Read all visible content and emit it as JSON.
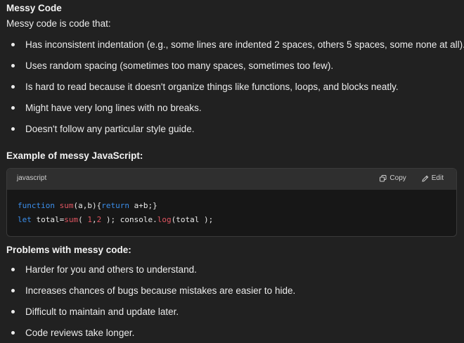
{
  "section1": {
    "title": "Messy Code",
    "intro": "Messy code is code that:",
    "bullets": [
      "Has inconsistent indentation (e.g., some lines are indented 2 spaces, others 5 spaces, some none at all).",
      "Uses random spacing (sometimes too many spaces, sometimes too few).",
      "Is hard to read because it doesn't organize things like functions, loops, and blocks neatly.",
      "Might have very long lines with no breaks.",
      "Doesn't follow any particular style guide."
    ]
  },
  "example": {
    "title": "Example of messy JavaScript:"
  },
  "codeblock": {
    "language": "javascript",
    "copy_label": "Copy",
    "edit_label": "Edit",
    "copy_icon": "copy-icon",
    "edit_icon": "pencil-icon",
    "lines": [
      "function sum(a,b){return a+b;}",
      "let total=sum( 1,2 ); console.log(total );"
    ],
    "colors": {
      "keyword": "#3b8eea",
      "function": "#e05561",
      "number": "#e05561"
    }
  },
  "section2": {
    "title": "Problems with messy code:",
    "bullets": [
      "Harder for you and others to understand.",
      "Increases chances of bugs because mistakes are easier to hide.",
      "Difficult to maintain and update later.",
      "Code reviews take longer."
    ]
  }
}
